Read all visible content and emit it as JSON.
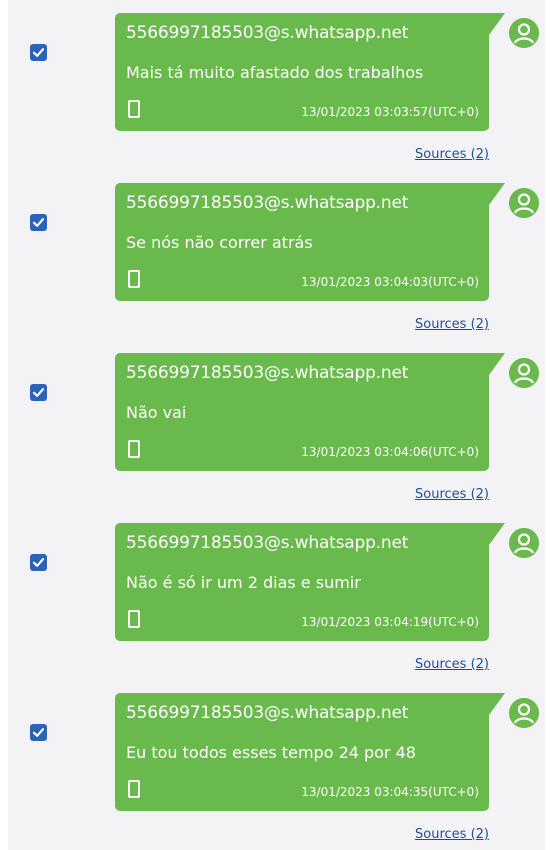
{
  "messages": [
    {
      "checked": true,
      "sender": "5566997185503@s.whatsapp.net",
      "text": "Mais tá muito afastado dos trabalhos",
      "timestamp": "13/01/2023 03:03:57(UTC+0)",
      "sources_label": "Sources (2)"
    },
    {
      "checked": true,
      "sender": "5566997185503@s.whatsapp.net",
      "text": "Se nós não correr atrás",
      "timestamp": "13/01/2023 03:04:03(UTC+0)",
      "sources_label": "Sources (2)"
    },
    {
      "checked": true,
      "sender": "5566997185503@s.whatsapp.net",
      "text": "Não vai",
      "timestamp": "13/01/2023 03:04:06(UTC+0)",
      "sources_label": "Sources (2)"
    },
    {
      "checked": true,
      "sender": "5566997185503@s.whatsapp.net",
      "text": "Não é só ir um 2 dias e sumir",
      "timestamp": "13/01/2023 03:04:19(UTC+0)",
      "sources_label": "Sources (2)"
    },
    {
      "checked": true,
      "sender": "5566997185503@s.whatsapp.net",
      "text": "Eu tou todos esses tempo 24 por 48",
      "timestamp": "13/01/2023 03:04:35(UTC+0)",
      "sources_label": "Sources (2)"
    }
  ],
  "icons": {
    "checkbox": "checkmark-icon",
    "device": "phone-icon",
    "avatar": "user-avatar-icon"
  },
  "colors": {
    "bubble": "#6ab94d",
    "checkbox": "#2b63b8",
    "link": "#1d4f99",
    "panel": "#f3f3f5"
  }
}
